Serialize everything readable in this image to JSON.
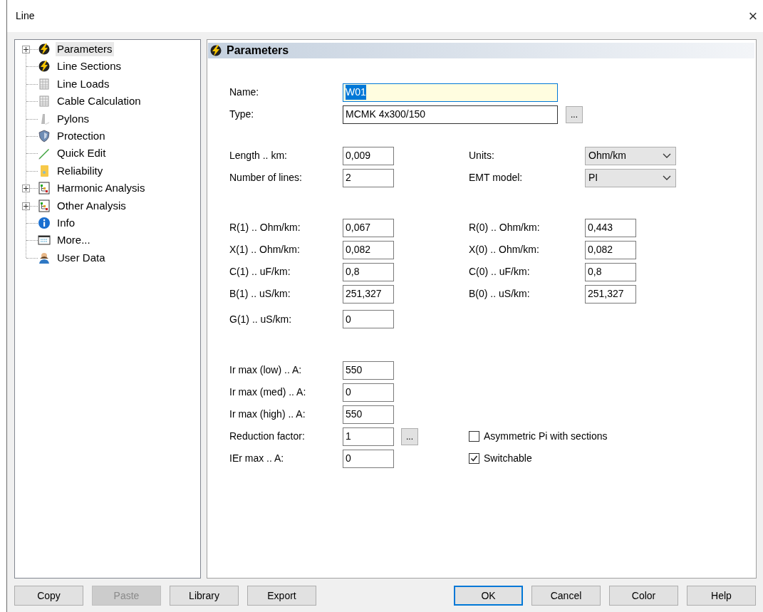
{
  "window": {
    "title": "Line",
    "close": "×"
  },
  "tree": [
    {
      "label": "Parameters",
      "expandable": true,
      "selected": true
    },
    {
      "label": "Line Sections",
      "expandable": false,
      "selected": false
    },
    {
      "label": "Line Loads",
      "expandable": false,
      "selected": false
    },
    {
      "label": "Cable Calculation",
      "expandable": false,
      "selected": false
    },
    {
      "label": "Pylons",
      "expandable": false,
      "selected": false
    },
    {
      "label": "Protection",
      "expandable": false,
      "selected": false
    },
    {
      "label": "Quick Edit",
      "expandable": false,
      "selected": false
    },
    {
      "label": "Reliability",
      "expandable": false,
      "selected": false
    },
    {
      "label": "Harmonic Analysis",
      "expandable": true,
      "selected": false
    },
    {
      "label": "Other Analysis",
      "expandable": true,
      "selected": false
    },
    {
      "label": "Info",
      "expandable": false,
      "selected": false
    },
    {
      "label": "More...",
      "expandable": false,
      "selected": false
    },
    {
      "label": "User Data",
      "expandable": false,
      "selected": false
    }
  ],
  "panel": {
    "title": "Parameters",
    "groups": [
      {
        "rows": [
          {
            "left": {
              "kind": "wide",
              "label": "Name:",
              "value": "W01",
              "focused": true
            }
          },
          {
            "left": {
              "kind": "wide",
              "label": "Type:",
              "value": "MCMK 4x300/150",
              "focused": false,
              "browse": "..."
            }
          }
        ]
      },
      {
        "rows": [
          {
            "left": {
              "kind": "text",
              "label": "Length .. km:",
              "value": "0,009"
            },
            "right": {
              "kind": "dropdown",
              "label": "Units:",
              "value": "Ohm/km"
            }
          },
          {
            "left": {
              "kind": "text",
              "label": "Number of lines:",
              "value": "2"
            },
            "right": {
              "kind": "dropdown",
              "label": "EMT model:",
              "value": "PI"
            }
          }
        ]
      },
      {
        "rows": [
          {
            "left": {
              "kind": "text",
              "label": "R(1) .. Ohm/km:",
              "value": "0,067"
            },
            "right": {
              "kind": "text",
              "label": "R(0) .. Ohm/km:",
              "value": "0,443"
            }
          },
          {
            "left": {
              "kind": "text",
              "label": "X(1) .. Ohm/km:",
              "value": "0,082"
            },
            "right": {
              "kind": "text",
              "label": "X(0) .. Ohm/km:",
              "value": "0,082"
            }
          },
          {
            "left": {
              "kind": "text",
              "label": "C(1) .. uF/km:",
              "value": "0,8"
            },
            "right": {
              "kind": "text",
              "label": "C(0) .. uF/km:",
              "value": "0,8"
            }
          },
          {
            "left": {
              "kind": "text",
              "label": "B(1) .. uS/km:",
              "value": "251,327"
            },
            "right": {
              "kind": "text",
              "label": "B(0) .. uS/km:",
              "value": "251,327"
            }
          },
          {
            "left": {
              "kind": "text",
              "label": "G(1) .. uS/km:",
              "value": "0"
            }
          }
        ]
      },
      {
        "rows": [
          {
            "left": {
              "kind": "text",
              "label": "Ir max (low) .. A:",
              "value": "550"
            }
          },
          {
            "left": {
              "kind": "text",
              "label": "Ir max (med) .. A:",
              "value": "0"
            }
          },
          {
            "left": {
              "kind": "text",
              "label": "Ir max (high) .. A:",
              "value": "550"
            }
          },
          {
            "left": {
              "kind": "text",
              "label": "Reduction factor:",
              "value": "1",
              "browse": "..."
            },
            "right": {
              "kind": "checkbox",
              "label": "Asymmetric Pi with sections",
              "checked": false
            }
          },
          {
            "left": {
              "kind": "text",
              "label": "IEr max .. A:",
              "value": "0"
            },
            "right": {
              "kind": "checkbox",
              "label": "Switchable",
              "checked": true
            }
          }
        ]
      }
    ]
  },
  "buttons": [
    {
      "label": "Copy",
      "disabled": false,
      "default": false
    },
    {
      "label": "Paste",
      "disabled": true,
      "default": false
    },
    {
      "label": "Library",
      "disabled": false,
      "default": false
    },
    {
      "label": "Export",
      "disabled": false,
      "default": false
    },
    {
      "label": "OK",
      "disabled": false,
      "default": true
    },
    {
      "label": "Cancel",
      "disabled": false,
      "default": false
    },
    {
      "label": "Color",
      "disabled": false,
      "default": false
    },
    {
      "label": "Help",
      "disabled": false,
      "default": false
    }
  ]
}
